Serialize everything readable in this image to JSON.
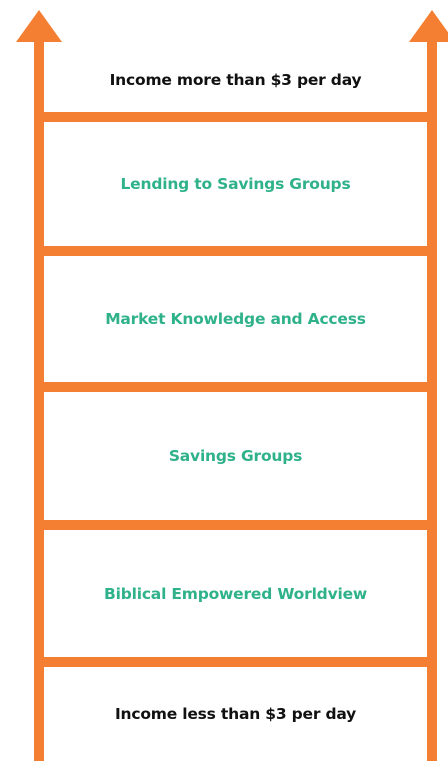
{
  "colors": {
    "rail": "#f47f32",
    "accent_text": "#2fb28a",
    "dark_text": "#111111"
  },
  "ladder": {
    "top_label": "Income more than $3 per day",
    "steps": [
      "Lending to Savings Groups",
      "Market Knowledge and Access",
      "Savings Groups",
      "Biblical Empowered Worldview"
    ],
    "bottom_label": "Income less than $3 per day"
  }
}
